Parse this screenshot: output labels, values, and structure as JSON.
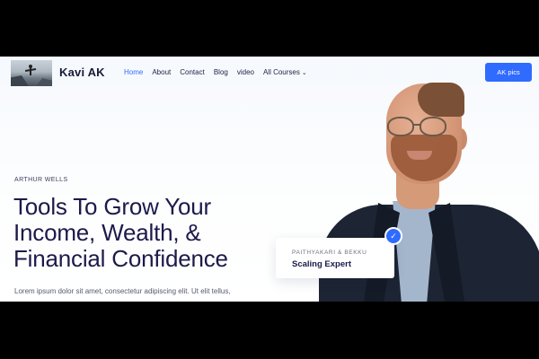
{
  "header": {
    "brand": "Kavi AK",
    "nav": [
      {
        "label": "Home",
        "active": true
      },
      {
        "label": "About",
        "active": false
      },
      {
        "label": "Contact",
        "active": false
      },
      {
        "label": "Blog",
        "active": false
      },
      {
        "label": "video",
        "active": false
      },
      {
        "label": "All Courses",
        "active": false,
        "has_dropdown": true
      }
    ],
    "cta_label": "AK pics"
  },
  "hero": {
    "eyebrow": "ARTHUR WELLS",
    "headline_line1": "Tools To Grow Your",
    "headline_line2": "Income, Wealth, &",
    "headline_line3": "Financial Confidence",
    "description": "Lorem ipsum dolor sit amet, consectetur adipiscing elit. Ut elit tellus,"
  },
  "badge": {
    "label": "PAITHYAKARI & BEKKU",
    "role": "Scaling Expert",
    "icon": "checkmark-icon"
  },
  "colors": {
    "accent": "#2f6bff",
    "heading": "#1c1a4a",
    "frame": "#000000"
  }
}
